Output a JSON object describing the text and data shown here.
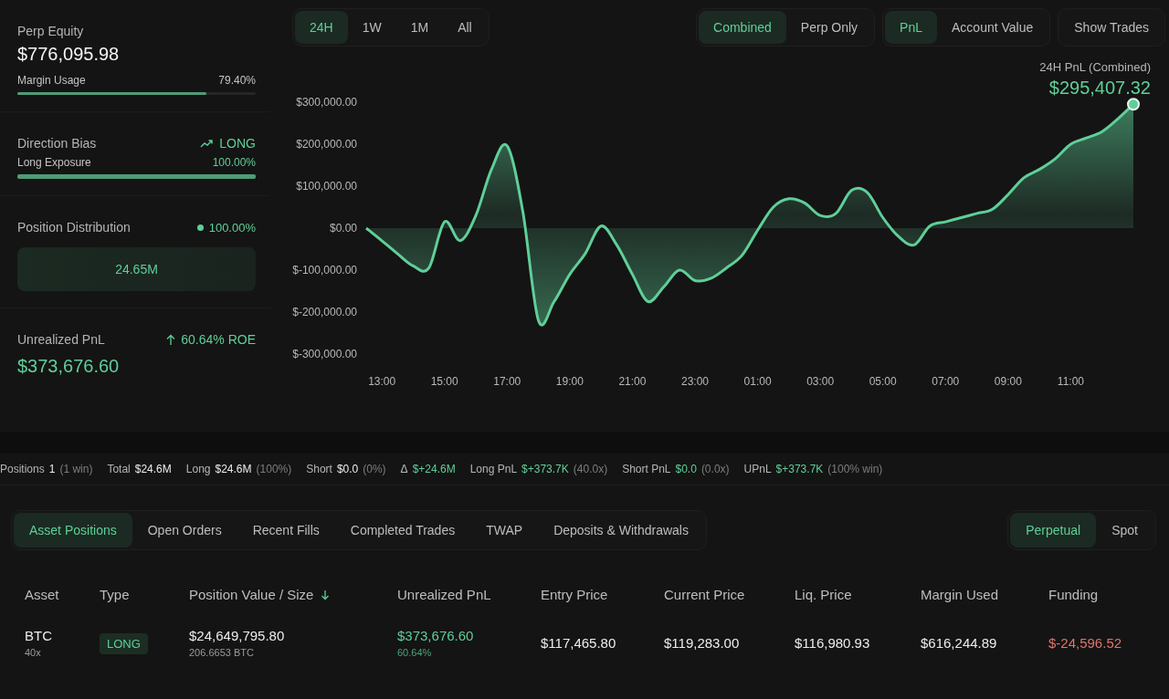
{
  "account": {
    "equity_label": "Perp Equity",
    "equity": "$776,095.98",
    "margin": {
      "label": "Margin Usage",
      "value": "79.40%",
      "level": 0.794
    },
    "bias_label": "Direction Bias",
    "bias": "LONG",
    "exposure": {
      "label": "Long Exposure",
      "value": "100.00%",
      "level": 1.0
    },
    "distribution_label": "Position Distribution",
    "distribution_value": "100.00%",
    "distribution_bar": "24.65M",
    "upnl_label": "Unrealized PnL",
    "roe": "60.64% ROE",
    "upnl": "$373,676.60"
  },
  "range_tabs": [
    {
      "label": "24H",
      "selected": true
    },
    {
      "label": "1W",
      "selected": false
    },
    {
      "label": "1M",
      "selected": false
    },
    {
      "label": "All",
      "selected": false
    }
  ],
  "scope_tabs": [
    {
      "label": "Combined",
      "selected": true
    },
    {
      "label": "Perp Only",
      "selected": false
    }
  ],
  "metric_tabs": [
    {
      "label": "PnL",
      "selected": true
    },
    {
      "label": "Account Value",
      "selected": false
    }
  ],
  "show_trades": "Show Trades",
  "summary": {
    "label": "24H PnL (Combined)",
    "value": "$295,407.32"
  },
  "chart_data": {
    "type": "area",
    "ylim": [
      -300000,
      300000
    ],
    "categories": [
      null,
      "13:00",
      null,
      null,
      null,
      "15:00",
      null,
      null,
      null,
      "17:00",
      null,
      null,
      null,
      "19:00",
      null,
      null,
      null,
      "21:00",
      null,
      null,
      null,
      "23:00",
      null,
      null,
      null,
      "01:00",
      null,
      null,
      null,
      "03:00",
      null,
      null,
      null,
      "05:00",
      null,
      null,
      null,
      "07:00",
      null,
      null,
      null,
      "09:00",
      null,
      null,
      null,
      "11:00",
      null,
      null,
      null,
      null
    ],
    "yticks": [
      {
        "value": 300000,
        "label": "$300,000.00"
      },
      {
        "value": 200000,
        "label": "$200,000.00"
      },
      {
        "value": 100000,
        "label": "$100,000.00"
      },
      {
        "value": 0,
        "label": "$0.00"
      },
      {
        "value": -100000,
        "label": "$-100,000.00"
      },
      {
        "value": -200000,
        "label": "$-200,000.00"
      },
      {
        "value": -300000,
        "label": "$-300,000.00"
      }
    ],
    "series": [
      {
        "color": "#5fcf98",
        "values": [
          0,
          -30000,
          -61000,
          -90000,
          -95000,
          15000,
          -30000,
          30000,
          140000,
          196000,
          40000,
          -220000,
          -175000,
          -110000,
          -60000,
          5000,
          -40000,
          -110000,
          -175000,
          -140000,
          -100000,
          -125000,
          -120000,
          -95000,
          -65000,
          -5000,
          50000,
          70000,
          60000,
          30000,
          35000,
          90000,
          85000,
          25000,
          -20000,
          -40000,
          5000,
          15000,
          25000,
          35000,
          45000,
          80000,
          120000,
          140000,
          165000,
          200000,
          215000,
          230000,
          260000,
          295000
        ]
      }
    ]
  },
  "stats": [
    {
      "label": "Positions",
      "value": "1",
      "note": "(1 win)",
      "positive": false
    },
    {
      "label": "Total",
      "value": "$24.6M",
      "positive": false
    },
    {
      "label": "Long",
      "value": "$24.6M",
      "note": "(100%)",
      "positive": false
    },
    {
      "label": "Short",
      "value": "$0.0",
      "note": "(0%)",
      "positive": false
    },
    {
      "label": "Δ",
      "value": "$+24.6M",
      "positive": true
    },
    {
      "label": "Long PnL",
      "value": "$+373.7K",
      "note": "(40.0x)",
      "positive": true
    },
    {
      "label": "Short PnL",
      "value": "$0.0",
      "note": "(0.0x)",
      "positive": true
    },
    {
      "label": "UPnL",
      "value": "$+373.7K",
      "note": "(100% win)",
      "positive": true
    }
  ],
  "section_tabs": [
    {
      "label": "Asset Positions",
      "selected": true
    },
    {
      "label": "Open Orders",
      "selected": false
    },
    {
      "label": "Recent Fills",
      "selected": false
    },
    {
      "label": "Completed Trades",
      "selected": false
    },
    {
      "label": "TWAP",
      "selected": false
    },
    {
      "label": "Deposits & Withdrawals",
      "selected": false
    }
  ],
  "market_tabs": [
    {
      "label": "Perpetual",
      "selected": true
    },
    {
      "label": "Spot",
      "selected": false
    }
  ],
  "table": {
    "columns": [
      {
        "label": "Asset",
        "sorted": false
      },
      {
        "label": "Type",
        "sorted": false
      },
      {
        "label": "Position Value / Size",
        "sorted": true
      },
      {
        "label": "Unrealized PnL",
        "sorted": false
      },
      {
        "label": "Entry Price",
        "sorted": false
      },
      {
        "label": "Current Price",
        "sorted": false
      },
      {
        "label": "Liq. Price",
        "sorted": false
      },
      {
        "label": "Margin Used",
        "sorted": false
      },
      {
        "label": "Funding",
        "sorted": false
      }
    ],
    "rows": [
      {
        "asset": "BTC",
        "leverage": "40x",
        "type": "LONG",
        "value": "$24,649,795.80",
        "size": "206.6653 BTC",
        "upnl": "$373,676.60",
        "upnl_pct": "60.64%",
        "upnl_positive": true,
        "entry": "$117,465.80",
        "current": "$119,283.00",
        "liq": "$116,980.93",
        "margin": "$616,244.89",
        "funding": "$-24,596.52",
        "funding_positive": false
      }
    ]
  }
}
